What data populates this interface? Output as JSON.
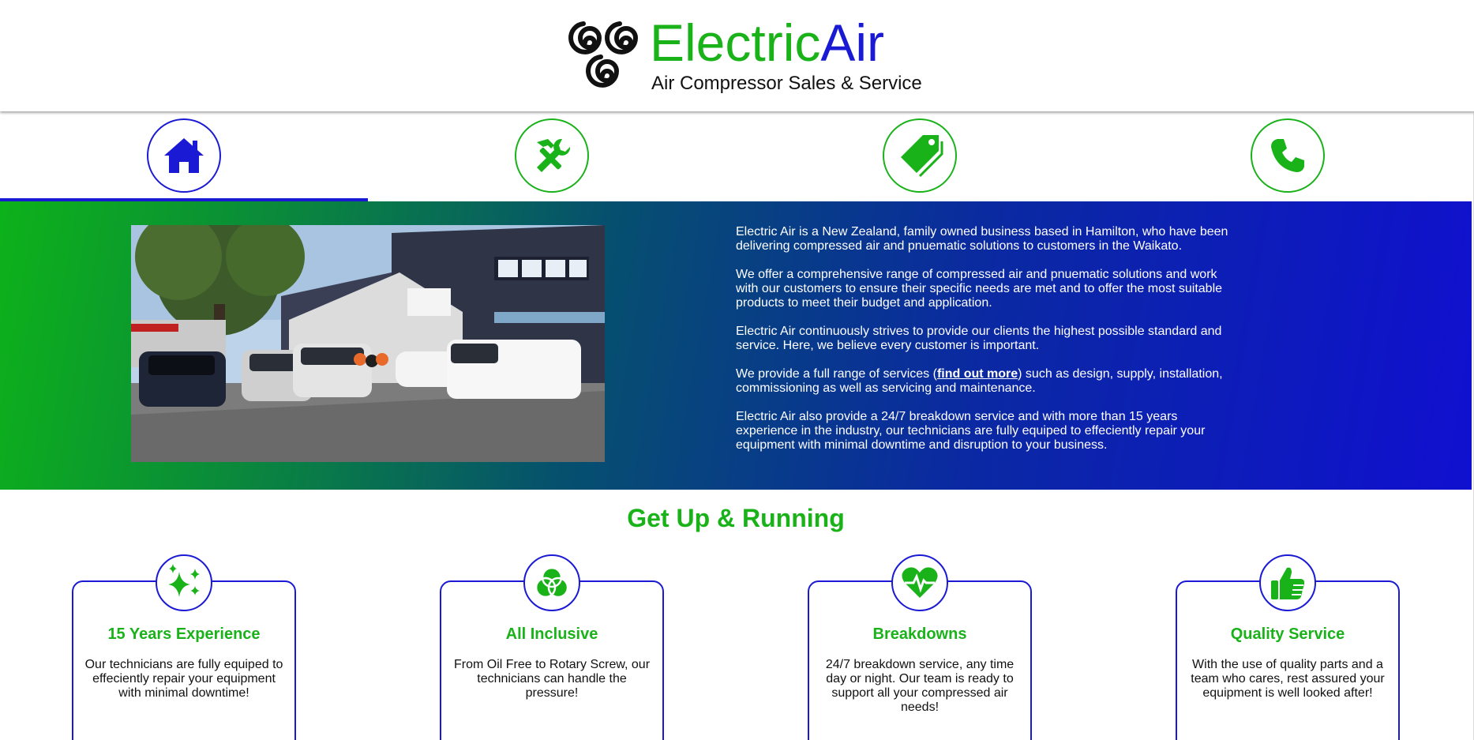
{
  "brand": {
    "name_part1": "Electric",
    "name_part2": "Air",
    "tagline": "Air Compressor Sales & Service"
  },
  "nav": {
    "items": [
      {
        "icon": "home-icon",
        "active": true
      },
      {
        "icon": "tools-icon",
        "active": false
      },
      {
        "icon": "price-tag-icon",
        "active": false
      },
      {
        "icon": "phone-icon",
        "active": false
      }
    ]
  },
  "hero": {
    "paragraphs": [
      "Electric Air is a New Zealand, family owned business based in Hamilton, who have been delivering compressed air and pnuematic solutions to customers in the Waikato.",
      "We offer a comprehensive range of compressed air and pnuematic solutions and work with our customers to ensure their specific needs are met and to offer the most suitable products to meet their budget and application.",
      "Electric Air continuously strives to provide our clients the highest possible standard and service. Here, we believe every customer is important."
    ],
    "services_prefix": "We provide a full range of services (",
    "services_link": "find out more",
    "services_suffix": ") such as design, supply, installation, commissioning as well as servicing and maintenance.",
    "breakdown_paragraph": "Electric Air also provide a 24/7 breakdown service and with more than 15 years experience in the industry, our technicians are fully equiped to effeciently repair your equipment with minimal downtime and disruption to your business."
  },
  "features": {
    "title": "Get Up & Running",
    "cards": [
      {
        "icon": "sparkles-icon",
        "title": "15 Years Experience",
        "text": "Our technicians are fully equiped to effeciently repair your equipment with minimal downtime!"
      },
      {
        "icon": "circles-icon",
        "title": "All Inclusive",
        "text": "From Oil Free to Rotary Screw, our technicians can handle the pressure!"
      },
      {
        "icon": "heartbeat-icon",
        "title": "Breakdowns",
        "text": "24/7 breakdown service, any time day or night. Our team is ready to support all your compressed air needs!"
      },
      {
        "icon": "thumbs-up-icon",
        "title": "Quality Service",
        "text": "With the use of quality parts and a team who cares, rest assured your equipment is well looked after!"
      }
    ]
  },
  "colors": {
    "green": "#19b219",
    "blue": "#1a1ad4"
  }
}
